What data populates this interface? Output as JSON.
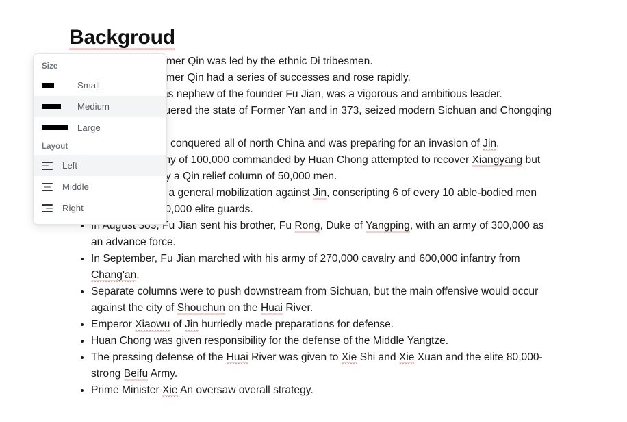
{
  "document": {
    "title": "Backgroud",
    "title_has_spellcheck_underline": true,
    "bullets": [
      "The state of Former Qin was led by the ethnic Di tribesmen.",
      "In the 350s, Former Qin had a series of successes and rose rapidly.",
      "Fu Jian, who was nephew of the founder Fu Jian, was a vigorous and ambitious leader.",
      "In 370, he conquered the state of Former Yan and in 373, seized modern Sichuan and Chongqing from Jin.",
      "By 376, Qin had conquered all of north China and was preparing for an invasion of Jin.",
      "In 378, a Jin army of 100,000 commanded by Huan Chong attempted to recover Xiangyang but was driven off by a Qin relief column of 50,000 men.",
      "Fu Jian ordered a general mobilization against Jin, conscripting 6 of every 10 able-bodied men and gathering 30,000 elite guards.",
      "In August 383, Fu Jian sent his brother, Fu Rong, Duke of Yangping, with an army of 300,000 as an advance force.",
      "In September, Fu Jian marched with his army of 270,000 cavalry and 600,000 infantry from Chang'an.",
      "Separate columns were to push downstream from Sichuan, but the main offensive would occur against the city of Shouchun on the Huai River.",
      "Emperor Xiaowu of Jin hurriedly made preparations for defense.",
      "Huan Chong was given responsibility for the defense of the Middle Yangtze.",
      "The pressing defense of the Huai River was given to Xie Shi and Xie Xuan and the elite 80,000-strong Beifu Army.",
      "Prime Minister Xie An oversaw overall strategy."
    ]
  },
  "format_menu": {
    "sections": [
      {
        "label": "Size",
        "name": "size",
        "items": [
          {
            "label": "Small",
            "icon": "size-bar-small-icon",
            "selected": false
          },
          {
            "label": "Medium",
            "icon": "size-bar-medium-icon",
            "selected": true
          },
          {
            "label": "Large",
            "icon": "size-bar-large-icon",
            "selected": false
          }
        ]
      },
      {
        "label": "Layout",
        "name": "layout",
        "items": [
          {
            "label": "Left",
            "icon": "align-left-icon",
            "selected": true
          },
          {
            "label": "Middle",
            "icon": "align-middle-icon",
            "selected": false
          },
          {
            "label": "Right",
            "icon": "align-right-icon",
            "selected": false
          }
        ]
      }
    ]
  },
  "colors": {
    "selected_row_background": "#f2f4f6",
    "menu_border": "#e6e6e6",
    "section_label": "#6f7680",
    "item_text": "#55595f",
    "body_text": "#1c1c1c",
    "spellcheck_underline": "#e0392b",
    "size_bar": "#000000"
  }
}
